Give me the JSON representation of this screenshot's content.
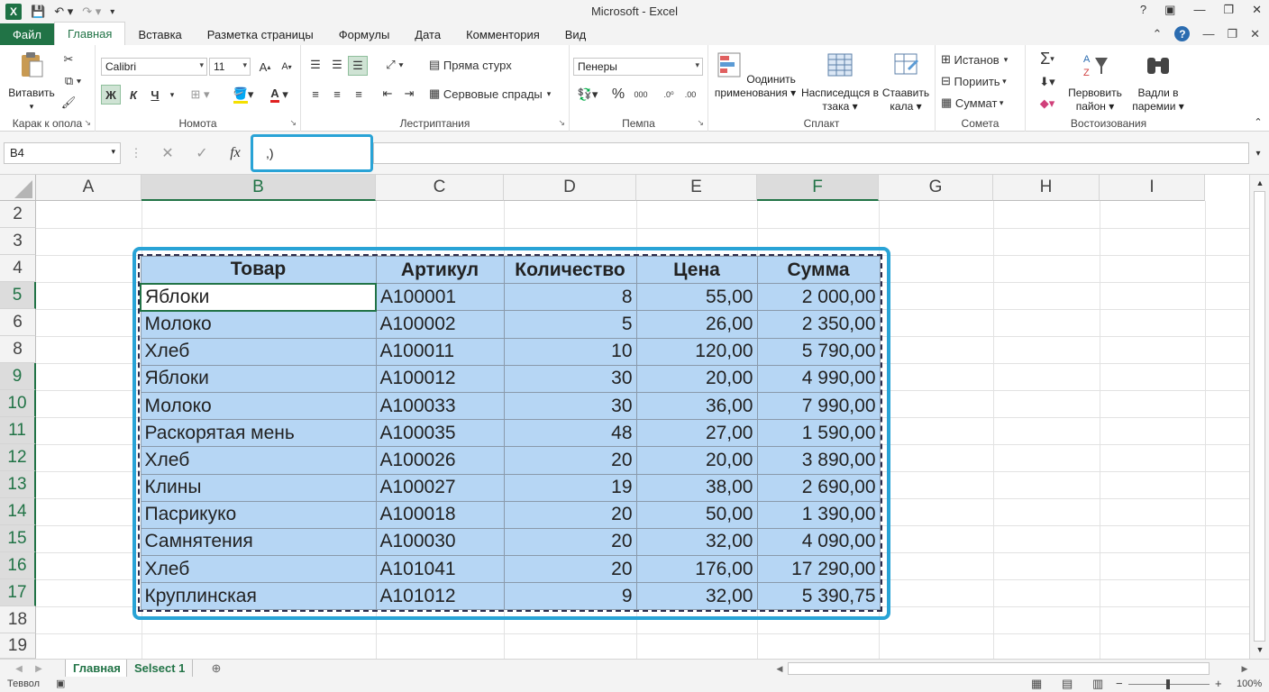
{
  "app": {
    "title": "Microsoft - Excel"
  },
  "tabs": [
    "Файл",
    "Главная",
    "Вставка",
    "Разметка страницы",
    "Формулы",
    "Дата",
    "Комментория",
    "Вид"
  ],
  "ribbon": {
    "clipboard": {
      "paste": "Витавить",
      "name": "Карак к опола"
    },
    "font": {
      "family": "Calibri",
      "size": "11",
      "bold": "Ж",
      "italic": "К",
      "underline": "Ч",
      "color_letter": "А",
      "name": "Номота"
    },
    "alignment": {
      "wrap": "Пряма стурх",
      "merge": "Сервовые спрады",
      "name": "Лестриптания"
    },
    "number": {
      "format": "Пенеры",
      "percent": "%",
      "thousands": "000",
      "name": "Пемпа"
    },
    "styles": {
      "cond": "Оодинить применования",
      "format_table": "Насписедщся в тзака",
      "cell_styles": "Стаавить калa",
      "name": "Сплакт"
    },
    "cells": {
      "insert": "Истанов",
      "delete": "Пориить",
      "format": "Суммат",
      "name": "Сомета"
    },
    "editing": {
      "sort": "Первовить пайон",
      "find": "Вадли в пaремии",
      "name": "Востоизования"
    }
  },
  "formula_bar": {
    "name_box": "B4",
    "fx": "fx",
    "value": ",)"
  },
  "columns": [
    "A",
    "B",
    "C",
    "D",
    "E",
    "F",
    "G",
    "H",
    "I"
  ],
  "rows": [
    "2",
    "3",
    "4",
    "5",
    "6",
    "8",
    "9",
    "10",
    "11",
    "12",
    "13",
    "14",
    "15",
    "16",
    "17",
    "18",
    "19"
  ],
  "table": {
    "headers": [
      "Товар",
      "Артикул",
      "Количество",
      "Цена",
      "Сумма"
    ],
    "rows": [
      [
        "Яблоки",
        "A100001",
        "8",
        "55,00",
        "2 000,00"
      ],
      [
        "Молоко",
        "A100002",
        "5",
        "26,00",
        "2 350,00"
      ],
      [
        "Хлеб",
        "A100011",
        "10",
        "120,00",
        "5 790,00"
      ],
      [
        "Яблоки",
        "A100012",
        "30",
        "20,00",
        "4 990,00"
      ],
      [
        "Молоко",
        "A100033",
        "30",
        "36,00",
        "7 990,00"
      ],
      [
        "Раскорятая мень",
        "A100035",
        "48",
        "27,00",
        "1 590,00"
      ],
      [
        "Хлеб",
        "A100026",
        "20",
        "20,00",
        "3 890,00"
      ],
      [
        "Клины",
        "A100027",
        "19",
        "38,00",
        "2 690,00"
      ],
      [
        "Пасрикуко",
        "A100018",
        "20",
        "50,00",
        "1 390,00"
      ],
      [
        "Самнятения",
        "A100030",
        "20",
        "32,00",
        "4 090,00"
      ],
      [
        "Хлеб",
        "A101041",
        "20",
        "176,00",
        "17 290,00"
      ],
      [
        "Круплинская",
        "A101012",
        "9",
        "32,00",
        "5 390,75"
      ]
    ]
  },
  "sheets": [
    "Главная",
    "Selsect 1"
  ],
  "status": {
    "mode": "Теввол",
    "zoom": "100%"
  },
  "colors": {
    "accent": "#217346",
    "selection": "#b6d6f4",
    "frame": "#29a3d6"
  }
}
